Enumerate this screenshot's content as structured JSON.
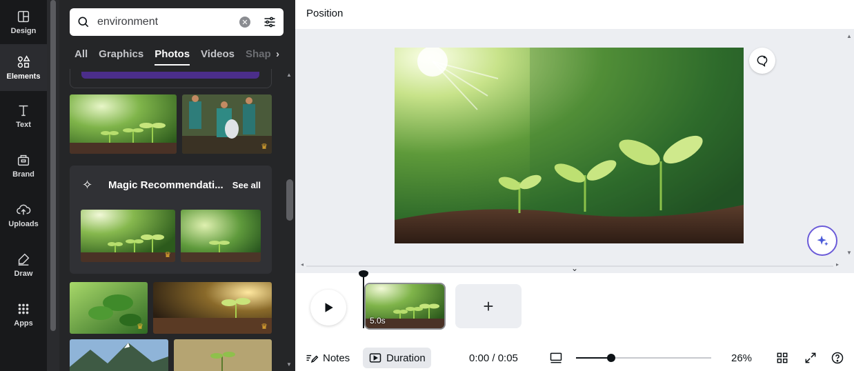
{
  "rail": {
    "items": [
      {
        "label": "Design",
        "icon": "design-icon"
      },
      {
        "label": "Elements",
        "icon": "elements-icon",
        "active": true
      },
      {
        "label": "Text",
        "icon": "text-icon"
      },
      {
        "label": "Brand",
        "icon": "brand-icon"
      },
      {
        "label": "Uploads",
        "icon": "uploads-icon"
      },
      {
        "label": "Draw",
        "icon": "draw-icon"
      },
      {
        "label": "Apps",
        "icon": "apps-icon"
      }
    ]
  },
  "search": {
    "value": "environment",
    "placeholder": "Search elements"
  },
  "tabs": [
    {
      "label": "All"
    },
    {
      "label": "Graphics"
    },
    {
      "label": "Photos",
      "active": true
    },
    {
      "label": "Videos"
    },
    {
      "label": "Shap"
    }
  ],
  "magic": {
    "title": "Magic Recommendati...",
    "see_all": "See all"
  },
  "topbar": {
    "title": "Position"
  },
  "timeline": {
    "clip_duration": "5.0s"
  },
  "bottombar": {
    "notes": "Notes",
    "duration": "Duration",
    "time": "0:00 / 0:05",
    "zoom": "26%",
    "zoom_level": 0.26
  },
  "colors": {
    "accent": "#6a5ad8",
    "crown": "#f5b731",
    "rail_bg": "#18191b",
    "panel_bg": "#252628"
  }
}
